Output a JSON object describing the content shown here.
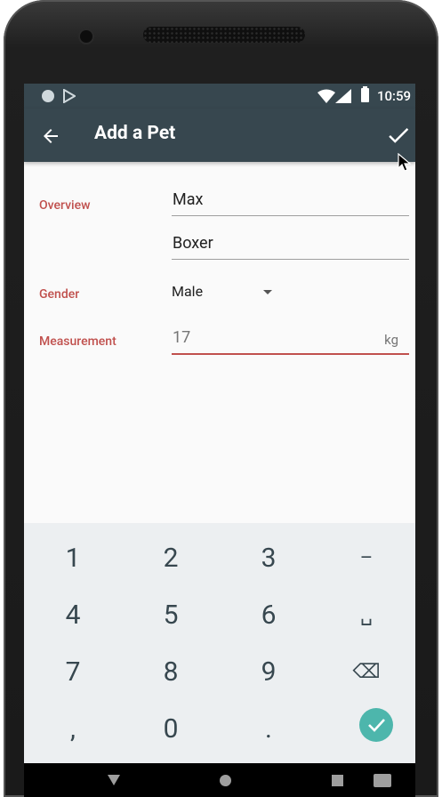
{
  "status_bar": {
    "time": "10:59"
  },
  "toolbar": {
    "title": "Add a Pet"
  },
  "form": {
    "overview_label": "Overview",
    "name_value": "Max",
    "breed_value": "Boxer",
    "gender_label": "Gender",
    "gender_value": "Male",
    "measurement_label": "Measurement",
    "weight_value": "17",
    "weight_unit": "kg"
  },
  "keyboard": {
    "keys": [
      "1",
      "2",
      "3",
      "–",
      "4",
      "5",
      "6",
      "␣",
      "7",
      "8",
      "9",
      "⌫",
      ",",
      "0",
      "."
    ]
  },
  "colors": {
    "toolbar": "#37474f",
    "label_accent": "#c0504d",
    "keyboard_bg": "#eceff1",
    "ok_key": "#4db6ac"
  }
}
